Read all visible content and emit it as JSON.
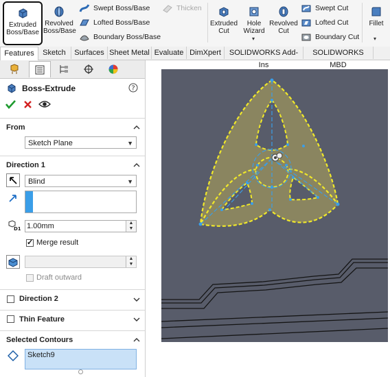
{
  "ribbon": {
    "extruded_boss": "Extruded Boss/Base",
    "revolved_boss": "Revolved Boss/Base",
    "swept_boss": "Swept Boss/Base",
    "lofted_boss": "Lofted Boss/Base",
    "boundary_boss": "Boundary Boss/Base",
    "thicken": "Thicken",
    "extruded_cut": "Extruded Cut",
    "hole_wizard": "Hole Wizard",
    "revolved_cut": "Revolved Cut",
    "swept_cut": "Swept Cut",
    "lofted_cut": "Lofted Cut",
    "boundary_cut": "Boundary Cut",
    "fillet": "Fillet"
  },
  "tabs": [
    "Features",
    "Sketch",
    "Surfaces",
    "Sheet Metal",
    "Evaluate",
    "DimXpert",
    "SOLIDWORKS Add-Ins",
    "SOLIDWORKS MBD"
  ],
  "panel": {
    "title": "Boss-Extrude",
    "from": {
      "header": "From",
      "selected": "Sketch Plane"
    },
    "direction1": {
      "header": "Direction 1",
      "end_condition": "Blind",
      "depth": "1.00mm",
      "merge_result": "Merge result",
      "merge_checked": true,
      "draft_outward": "Draft outward"
    },
    "direction2": {
      "header": "Direction 2",
      "checked": false
    },
    "thin_feature": {
      "header": "Thin Feature",
      "checked": false
    },
    "selected_contours": {
      "header": "Selected Contours",
      "item": "Sketch9"
    }
  },
  "colors": {
    "viewport_bg": "#585c6a",
    "triquetra_fill": "#8a8560",
    "triquetra_outline": "#f0e82a",
    "sketch_blue": "#3a9ee8",
    "confirm_green": "#1e9a2e",
    "cancel_red": "#d21f1f",
    "selection_blue": "#c9e1f7"
  }
}
